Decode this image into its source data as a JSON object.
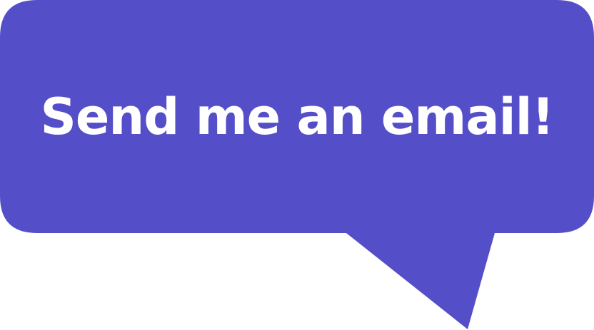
{
  "bubble": {
    "text": "Send me an email!",
    "fill_color": "#554ec9",
    "text_color": "#ffffff"
  }
}
